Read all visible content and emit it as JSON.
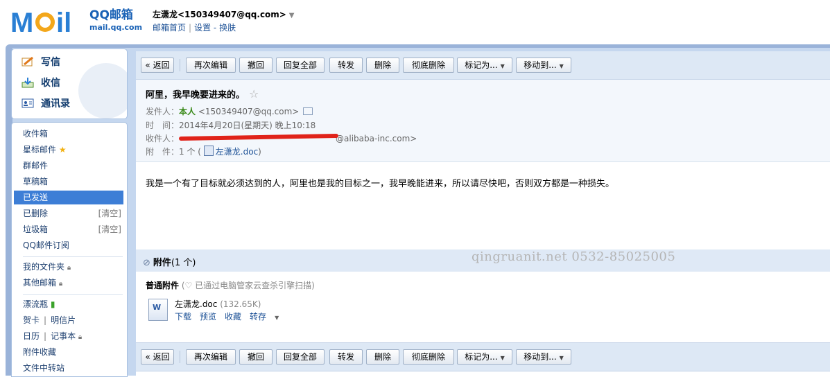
{
  "brand": {
    "mail_word": "Mail",
    "name_cn": "QQ邮箱",
    "url": "mail.qq.com"
  },
  "user": {
    "display": "左潇龙<150349407@qq.com>",
    "arrow": "▼",
    "links": {
      "home": "邮箱首页",
      "settings": "设置",
      "dash": "-",
      "skin": "换肤"
    }
  },
  "nav_top": {
    "compose": "写信",
    "inbox_check": "收信",
    "contacts": "通讯录"
  },
  "nav": {
    "inbox": "收件箱",
    "starred": "星标邮件",
    "group": "群邮件",
    "drafts": "草稿箱",
    "sent": "已发送",
    "deleted": "已删除",
    "deleted_clear": "[清空]",
    "spam": "垃圾箱",
    "spam_clear": "[清空]",
    "subscribe": "QQ邮件订阅",
    "my_folders": "我的文件夹",
    "other_mail": "其他邮箱",
    "bottle": "漂流瓶",
    "card": "贺卡",
    "postcard": "明信片",
    "calendar": "日历",
    "notes": "记事本",
    "attach_fav": "附件收藏",
    "file_transfer": "文件中转站",
    "sep": "|"
  },
  "toolbar": {
    "back": "« 返回",
    "reedit": "再次编辑",
    "recall": "撤回",
    "reply_all": "回复全部",
    "forward": "转发",
    "delete": "删除",
    "delete_forever": "彻底删除",
    "mark_as": "标记为...",
    "move_to": "移动到...",
    "dropdown": "▼"
  },
  "mail": {
    "subject": "阿里，我早晚要进来的。",
    "star": "☆",
    "from_label": "发件人：",
    "from_name": "本人",
    "from_addr": "<150349407@qq.com>",
    "time_label": "时　间：",
    "time_value": "2014年4月20日(星期天) 晚上10:18",
    "to_label": "收件人：",
    "to_value": "@alibaba-inc.com>",
    "att_label": "附　件：",
    "att_count": "1 个 (",
    "att_name": "左潇龙.doc",
    "att_close": ")",
    "body": "我是一个有了目标就必须达到的人，阿里也是我的目标之一，我早晚能进来，所以请尽快吧，否则双方都是一种损失。"
  },
  "attachments": {
    "header": "附件",
    "header_count": "(1 个)",
    "kind": "普通附件",
    "scan_note": "(♡ 已通过电脑管家云查杀引擎扫描)",
    "file_name": "左潇龙.doc",
    "file_size": "(132.65K)",
    "actions": {
      "download": "下载",
      "preview": "预览",
      "collect": "收藏",
      "save": "转存"
    }
  },
  "watermark": "qingruanit.net 0532-85025005",
  "colors": {
    "accent": "#3d7ed6",
    "frame": "#9ab3d9",
    "link": "#1a4f95",
    "redaction": "#e0231a"
  }
}
